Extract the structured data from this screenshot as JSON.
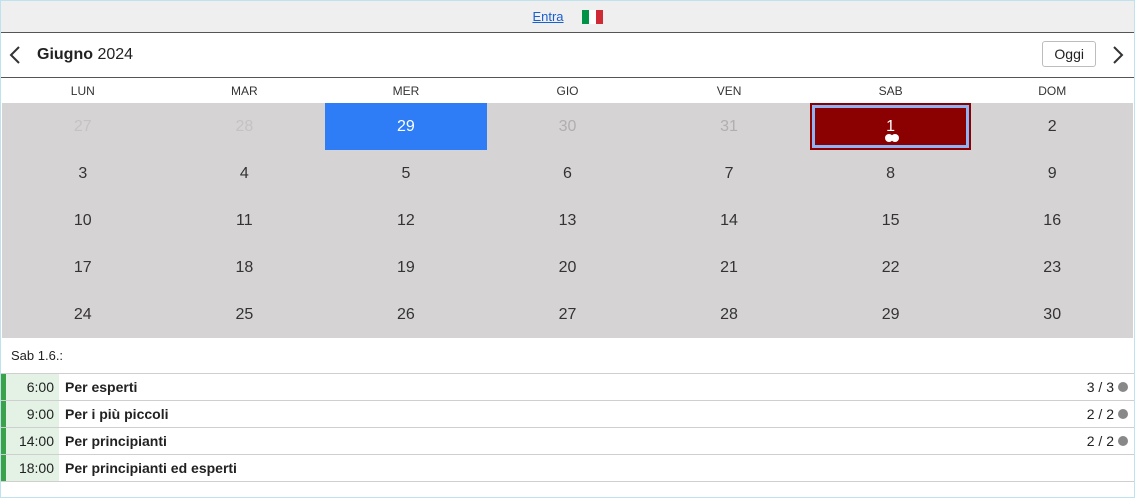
{
  "topbar": {
    "login_label": "Entra",
    "flag_colors": [
      "#009246",
      "#ffffff",
      "#ce2b37"
    ]
  },
  "calendar": {
    "month_name": "Giugno",
    "year": "2024",
    "today_label": "Oggi",
    "weekdays": [
      "LUN",
      "MAR",
      "MER",
      "GIO",
      "VEN",
      "SAB",
      "DOM"
    ],
    "days": [
      {
        "label": "27",
        "state": "muted"
      },
      {
        "label": "28",
        "state": "muted"
      },
      {
        "label": "29",
        "state": "today"
      },
      {
        "label": "30",
        "state": "grey"
      },
      {
        "label": "31",
        "state": "grey"
      },
      {
        "label": "1",
        "state": "selected",
        "dots": 2
      },
      {
        "label": "2",
        "state": ""
      },
      {
        "label": "3",
        "state": ""
      },
      {
        "label": "4",
        "state": ""
      },
      {
        "label": "5",
        "state": ""
      },
      {
        "label": "6",
        "state": ""
      },
      {
        "label": "7",
        "state": ""
      },
      {
        "label": "8",
        "state": ""
      },
      {
        "label": "9",
        "state": ""
      },
      {
        "label": "10",
        "state": ""
      },
      {
        "label": "11",
        "state": ""
      },
      {
        "label": "12",
        "state": ""
      },
      {
        "label": "13",
        "state": ""
      },
      {
        "label": "14",
        "state": ""
      },
      {
        "label": "15",
        "state": ""
      },
      {
        "label": "16",
        "state": ""
      },
      {
        "label": "17",
        "state": ""
      },
      {
        "label": "18",
        "state": ""
      },
      {
        "label": "19",
        "state": ""
      },
      {
        "label": "20",
        "state": ""
      },
      {
        "label": "21",
        "state": ""
      },
      {
        "label": "22",
        "state": ""
      },
      {
        "label": "23",
        "state": ""
      },
      {
        "label": "24",
        "state": ""
      },
      {
        "label": "25",
        "state": ""
      },
      {
        "label": "26",
        "state": ""
      },
      {
        "label": "27",
        "state": ""
      },
      {
        "label": "28",
        "state": ""
      },
      {
        "label": "29",
        "state": ""
      },
      {
        "label": "30",
        "state": ""
      }
    ],
    "colors": {
      "grid_bg": "#d5d3d4",
      "today": "#2e7cf6",
      "selected": "#8b0000",
      "selected_outline": "#8fb4f4"
    }
  },
  "selected_day": {
    "label": "Sab 1.6.:",
    "events": [
      {
        "time": "6:00",
        "title": "Per esperti",
        "count": "3 / 3"
      },
      {
        "time": "9:00",
        "title": "Per i più piccoli",
        "count": "2 / 2"
      },
      {
        "time": "14:00",
        "title": "Per principianti",
        "count": "2 / 2"
      },
      {
        "time": "18:00",
        "title": "Per principianti ed esperti",
        "count": ""
      }
    ],
    "colors": {
      "event_bar": "#3aa34a",
      "event_time_bg": "#e4f2e6",
      "status_dot": "#888888"
    }
  }
}
